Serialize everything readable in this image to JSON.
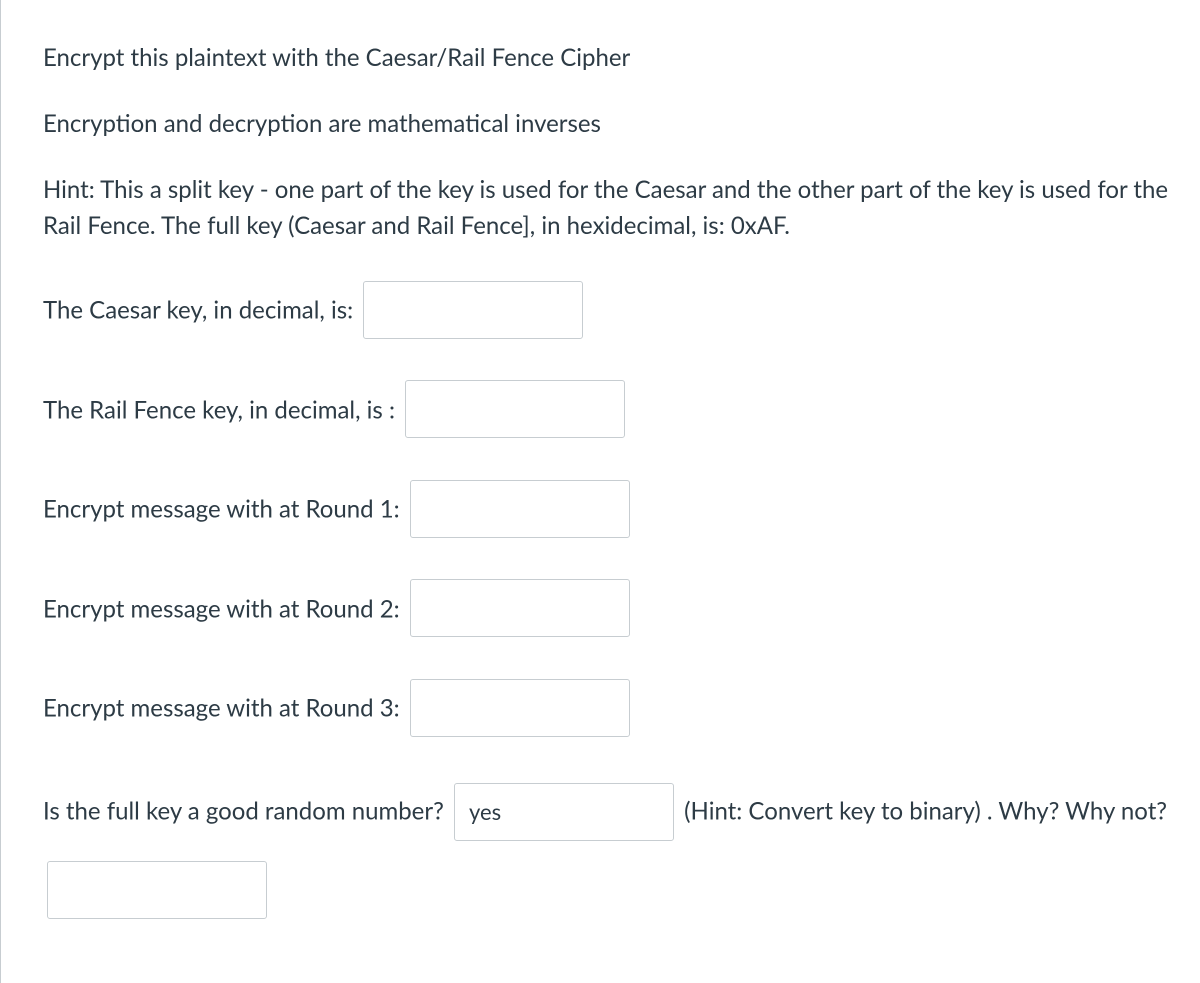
{
  "intro": {
    "line1": "Encrypt this plaintext with the Caesar/Rail Fence Cipher",
    "line2": "Encryption and decryption are mathematical inverses",
    "hint": "Hint: This a split key - one part of the key is used for the Caesar and the other part of the key is used for the Rail Fence. The full key (Caesar and Rail Fence], in hexidecimal, is: 0xAF."
  },
  "fields": {
    "caesar_label": "The Caesar key, in decimal, is: ",
    "caesar_value": "",
    "railfence_label": "The Rail Fence key, in decimal, is : ",
    "railfence_value": "",
    "round1_label": "Encrypt message with at Round 1: ",
    "round1_value": "",
    "round2_label": "Encrypt message with at Round 2: ",
    "round2_value": "",
    "round3_label": "Encrypt message with at Round 3: ",
    "round3_value": ""
  },
  "random_q": {
    "label_before": "Is the full key a good random number? ",
    "value": "yes",
    "label_after": " (Hint: Convert key to binary) . Why? Why not? ",
    "why_value": ""
  }
}
